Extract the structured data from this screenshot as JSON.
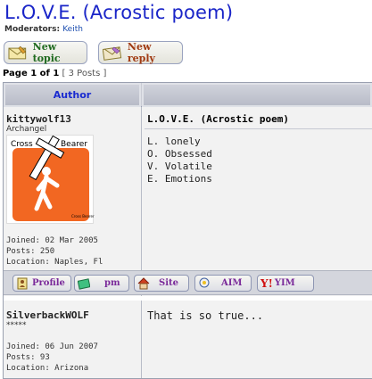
{
  "topic": {
    "title": "L.O.V.E. (Acrostic poem)",
    "moderators_label": "Moderators:",
    "moderator_name": "Keith"
  },
  "actions": {
    "new_topic": "New topic",
    "new_reply": "New reply"
  },
  "pagination": {
    "page_text": "Page 1 of 1",
    "posts_text": "[ 3 Posts ]"
  },
  "table": {
    "author_header": "Author"
  },
  "posts": [
    {
      "author": "kittywolf13",
      "rank": "Archangel",
      "avatar_text_left": "Cross",
      "avatar_text_right": "Bearer",
      "avatar_caption": "Cross Bearer",
      "joined": "Joined: 02 Mar 2005",
      "posts": "Posts: 250",
      "location": "Location: Naples, Fl",
      "subject": "L.O.V.E. (Acrostic poem)",
      "body": [
        "L. lonely",
        "O. Obsessed",
        "V. Volatile",
        "E. Emotions"
      ]
    },
    {
      "author": "SilverbackWOLF",
      "rank": "*****",
      "joined": "Joined: 06 Jun 2007",
      "posts": "Posts: 93",
      "location": "Location: Arizona",
      "body": [
        "That is so true..."
      ]
    }
  ],
  "profile_buttons": {
    "profile": "Profile",
    "pm": "pm",
    "site": "Site",
    "aim": "AIM",
    "yim": "YIM"
  },
  "colors": {
    "title": "#1a25c8",
    "header_text": "#1a2bd0",
    "avatar_orange": "#f26722"
  },
  "icons": [
    "envelope-icon",
    "envelope-icon",
    "profile-icon",
    "pm-icon",
    "house-icon",
    "aim-icon",
    "yahoo-icon"
  ]
}
